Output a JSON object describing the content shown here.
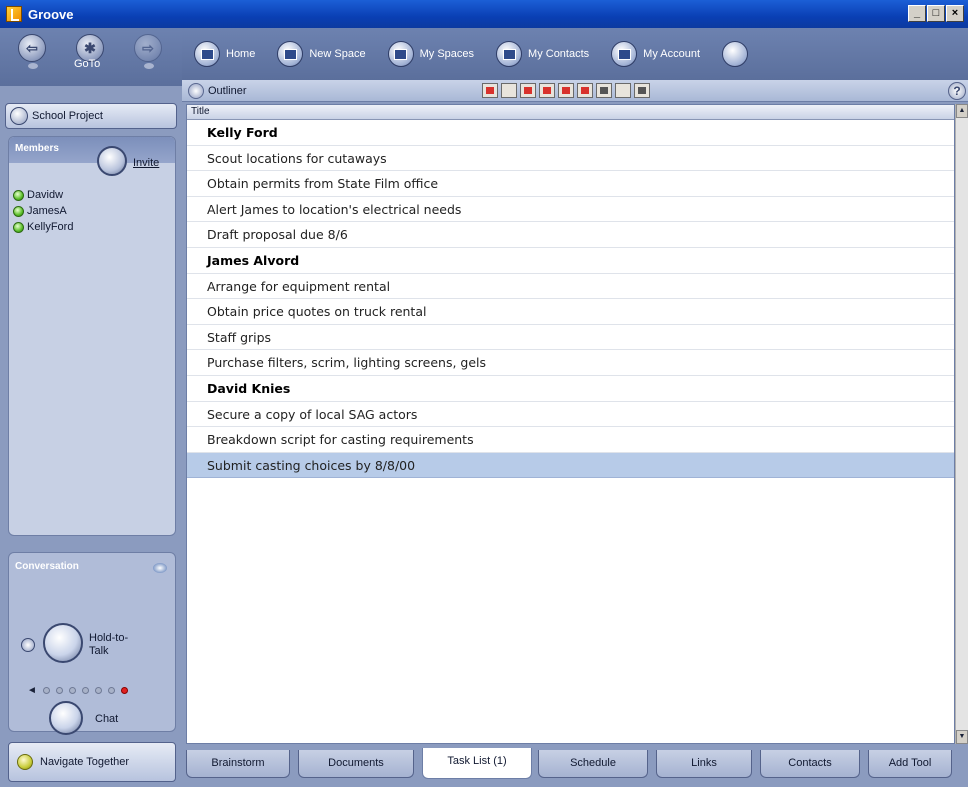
{
  "window": {
    "title": "Groove",
    "controls": [
      "_",
      "□",
      "×"
    ]
  },
  "nav": {
    "goto_label": "GoTo"
  },
  "toolbar": {
    "buttons": [
      {
        "label": "Home",
        "icon": "home-icon"
      },
      {
        "label": "New Space",
        "icon": "new-space-icon"
      },
      {
        "label": "My Spaces",
        "icon": "spaces-icon"
      },
      {
        "label": "My Contacts",
        "icon": "contacts-icon"
      },
      {
        "label": "My Account",
        "icon": "account-icon"
      }
    ]
  },
  "tool": {
    "name": "Outliner",
    "help": "?"
  },
  "sidebar": {
    "space_name": "School Project",
    "members_title": "Members",
    "invite_label": "Invite",
    "members": [
      "Davidw",
      "JamesA",
      "KellyFord"
    ],
    "conversation_title": "Conversation",
    "hold_to_talk_label": "Hold-to-Talk",
    "chat_label": "Chat",
    "navigate_together_label": "Navigate Together"
  },
  "table": {
    "column_header": "Title",
    "rows": [
      {
        "text": "Kelly Ford",
        "heading": true
      },
      {
        "text": "Scout locations for cutaways"
      },
      {
        "text": "Obtain permits from State Film office"
      },
      {
        "text": "Alert James to location's electrical needs"
      },
      {
        "text": "Draft proposal due 8/6"
      },
      {
        "text": "James Alvord",
        "heading": true
      },
      {
        "text": "Arrange for equipment rental"
      },
      {
        "text": "Obtain price quotes on truck rental"
      },
      {
        "text": "Staff grips"
      },
      {
        "text": "Purchase filters, scrim, lighting screens, gels"
      },
      {
        "text": "David Knies",
        "heading": true
      },
      {
        "text": "Secure a copy of local SAG actors"
      },
      {
        "text": "Breakdown script for casting requirements"
      },
      {
        "text": "Submit casting choices by 8/8/00",
        "selected": true
      }
    ]
  },
  "tabs": [
    {
      "label": "Brainstorm"
    },
    {
      "label": "Documents"
    },
    {
      "label": "Task List (1)",
      "active": true
    },
    {
      "label": "Schedule"
    },
    {
      "label": "Links"
    },
    {
      "label": "Contacts"
    },
    {
      "label": "Add Tool"
    }
  ],
  "colors": {
    "titlebar": "#0a3fb4",
    "selection": "#b7cbe8",
    "presence": "#5bbf2a"
  }
}
